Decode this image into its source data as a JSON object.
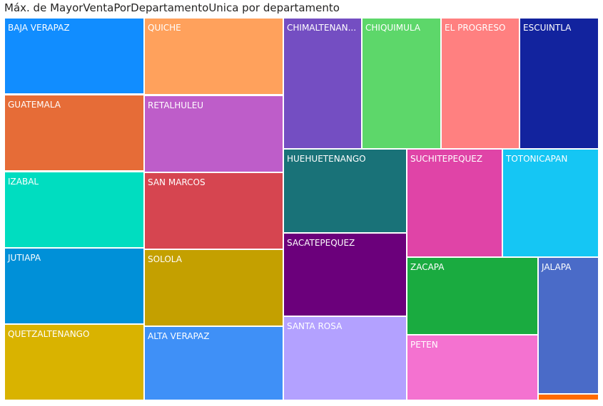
{
  "chart_data": {
    "type": "treemap",
    "title": "Máx. de MayorVentaPorDepartamentoUnica por departamento",
    "categories": [
      {
        "label": "BAJA VERAPAZ",
        "color": "#118DFF"
      },
      {
        "label": "GUATEMALA",
        "color": "#E66C37"
      },
      {
        "label": "IZABAL",
        "color": "#00DDC0"
      },
      {
        "label": "JUTIAPA",
        "color": "#0090D8"
      },
      {
        "label": "QUETZALTENANGO",
        "color": "#D9B300"
      },
      {
        "label": "QUICHE",
        "color": "#FFA15C"
      },
      {
        "label": "RETALHULEU",
        "color": "#BE5DC9"
      },
      {
        "label": "SAN MARCOS",
        "color": "#D64550"
      },
      {
        "label": "SOLOLA",
        "color": "#C4A000"
      },
      {
        "label": "ALTA VERAPAZ",
        "color": "#3F90F7"
      },
      {
        "label": "CHIMALTENAN...",
        "color": "#744EC2"
      },
      {
        "label": "CHIQUIMULA",
        "color": "#5DD76A"
      },
      {
        "label": "EL PROGRESO",
        "color": "#FF8080"
      },
      {
        "label": "ESCUINTLA",
        "color": "#12239E"
      },
      {
        "label": "HUEHUETENANGO",
        "color": "#197278"
      },
      {
        "label": "SACATEPEQUEZ",
        "color": "#6B007B"
      },
      {
        "label": "SANTA ROSA",
        "color": "#B3A1FF"
      },
      {
        "label": "SUCHITEPEQUEZ",
        "color": "#E044A7"
      },
      {
        "label": "TOTONICAPAN",
        "color": "#15C6F4"
      },
      {
        "label": "ZACAPA",
        "color": "#1AAB40"
      },
      {
        "label": "PETEN",
        "color": "#F472D0"
      },
      {
        "label": "JALAPA",
        "color": "#4A6BC8"
      },
      {
        "label": "",
        "color": "#FF6B00"
      }
    ]
  }
}
